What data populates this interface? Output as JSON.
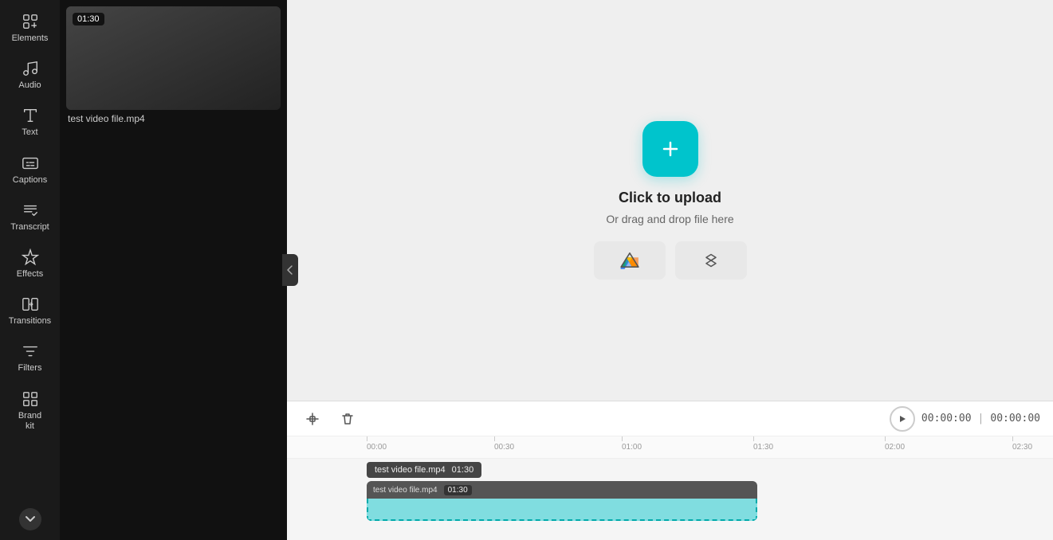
{
  "sidebar": {
    "items": [
      {
        "id": "elements",
        "label": "Elements",
        "icon": "elements"
      },
      {
        "id": "audio",
        "label": "Audio",
        "icon": "audio"
      },
      {
        "id": "text",
        "label": "Text",
        "icon": "text"
      },
      {
        "id": "captions",
        "label": "Captions",
        "icon": "captions"
      },
      {
        "id": "transcript",
        "label": "Transcript",
        "icon": "transcript"
      },
      {
        "id": "effects",
        "label": "Effects",
        "icon": "effects"
      },
      {
        "id": "transitions",
        "label": "Transitions",
        "icon": "transitions"
      },
      {
        "id": "filters",
        "label": "Filters",
        "icon": "filters"
      },
      {
        "id": "brand",
        "label": "Brand\nkit",
        "icon": "brand"
      }
    ],
    "chevron_label": "▼"
  },
  "media_panel": {
    "item": {
      "filename": "test video file.mp4",
      "duration": "01:30"
    }
  },
  "upload": {
    "title": "Click to upload",
    "subtitle": "Or drag and drop file here",
    "google_drive_label": "Google Drive",
    "dropbox_label": "Dropbox"
  },
  "timeline": {
    "play_btn_label": "▶",
    "current_time": "00:00:00",
    "separator": "|",
    "total_time": "00:00:00",
    "ruler_marks": [
      "00:00",
      "00:30",
      "01:00",
      "01:30",
      "02:00",
      "02:30"
    ],
    "clip": {
      "filename": "test video file.mp4",
      "duration": "01:30"
    },
    "tools": {
      "trim": "trim",
      "delete": "delete"
    }
  }
}
